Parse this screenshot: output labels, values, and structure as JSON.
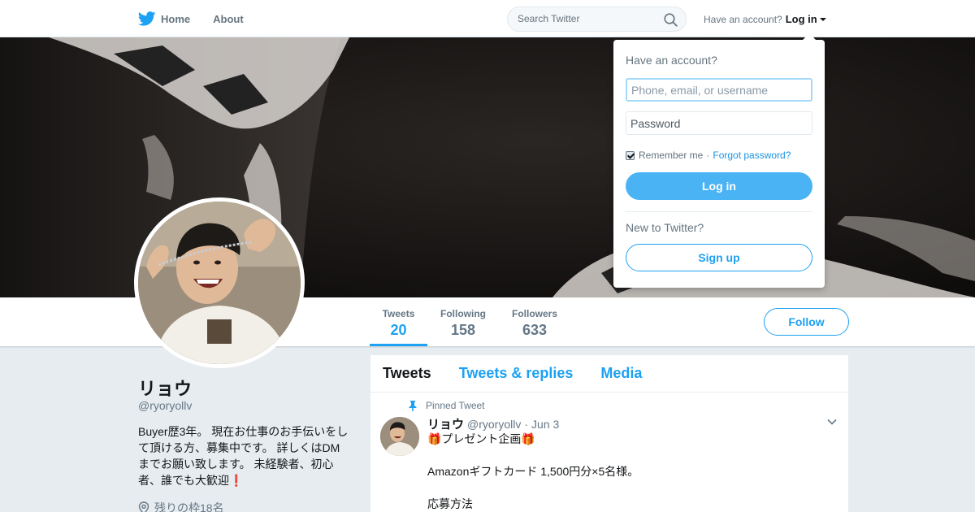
{
  "nav": {
    "home_label": "Home",
    "about_label": "About",
    "search_placeholder": "Search Twitter",
    "account_prompt": "Have an account?",
    "login_label": "Log in"
  },
  "profile": {
    "name": "リョウ",
    "handle": "@ryoryollv",
    "bio": "Buyer歴3年。 現在お仕事のお手伝いをして頂ける方、募集中です。 詳しくはDMまでお願い致します。 未経験者、初心者、誰でも大歓迎",
    "bio_emoji": "❗",
    "location": "残りの枠18名"
  },
  "stats": [
    {
      "label": "Tweets",
      "value": "20"
    },
    {
      "label": "Following",
      "value": "158"
    },
    {
      "label": "Followers",
      "value": "633"
    }
  ],
  "follow_label": "Follow",
  "timeline": {
    "tabs": [
      "Tweets",
      "Tweets & replies",
      "Media"
    ],
    "pinned_label": "Pinned Tweet",
    "tweet": {
      "name": "リョウ",
      "handle": "@ryoryollv",
      "separator": "·",
      "date": "Jun 3",
      "body": "🎁プレゼント企画🎁\n\nAmazonギフトカード 1,500円分×5名様。\n\n応募方法"
    }
  },
  "login_dropdown": {
    "title": "Have an account?",
    "username_placeholder": "Phone, email, or username",
    "password_placeholder": "Password",
    "remember_label": "Remember me",
    "separator": "·",
    "forgot_label": "Forgot password?",
    "login_button": "Log in",
    "new_prompt": "New to Twitter?",
    "signup_button": "Sign up"
  },
  "colors": {
    "accent": "#1da1f2",
    "login_button_bg": "#4ab3f4",
    "page_bg": "#e6ecf0"
  },
  "icons": [
    "twitter-bird-icon",
    "home-icon",
    "search-icon",
    "caret-down-icon",
    "pin-icon",
    "location-icon",
    "chevron-down-icon",
    "checkbox-checked-icon"
  ]
}
